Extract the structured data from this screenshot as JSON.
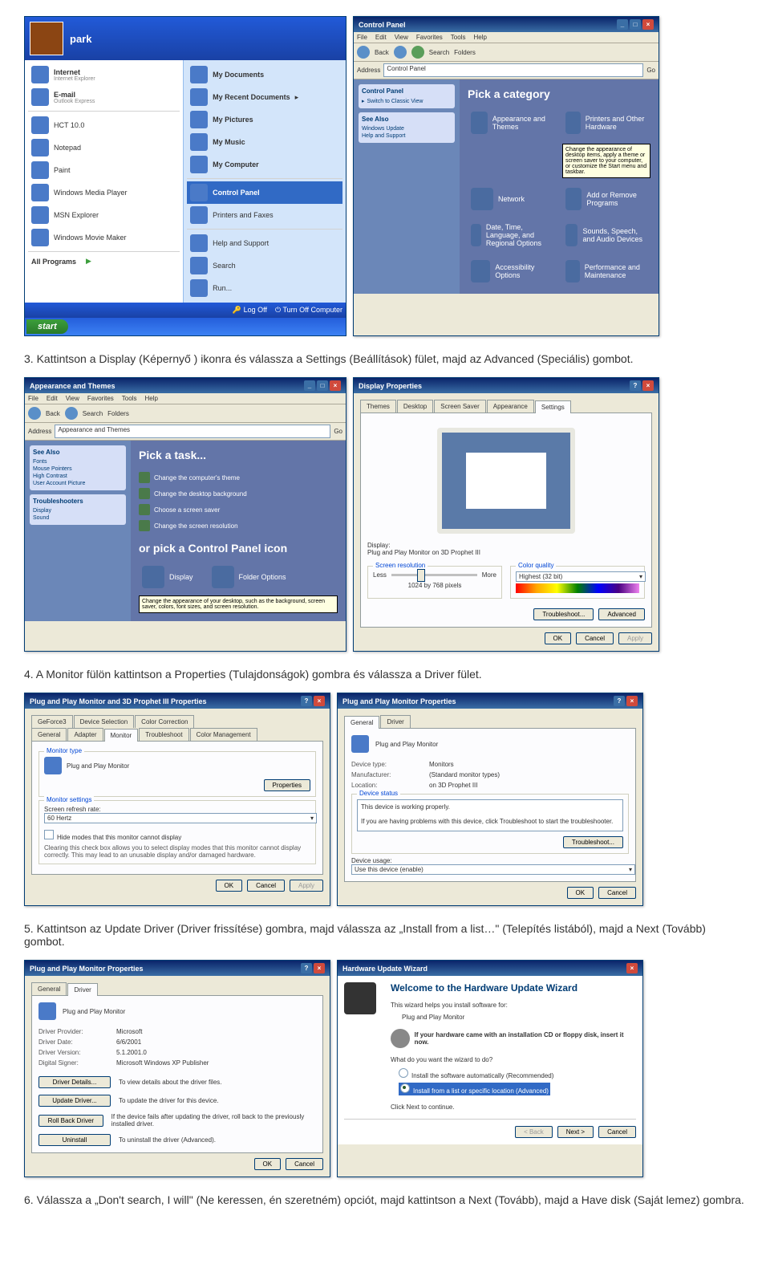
{
  "steps": {
    "s3": "3.  Kattintson a Display (Képernyő ) ikonra és válassza a Settings (Beállítások) fület, majd az Advanced (Speciális) gombot.",
    "s4": "4.  A Monitor fülön kattintson a Properties (Tulajdonságok) gombra és válassza a Driver fület.",
    "s5": "5.  Kattintson az Update Driver (Driver frissítése) gombra, majd válassza az „Install from a list…\" (Telepítés listából), majd a Next (Tovább) gombot.",
    "s6": "6.  Válassza a „Don't search, I will\" (Ne keressen, én szeretném) opciót, majd kattintson a Next (Tovább), majd a Have disk (Saját lemez) gombra."
  },
  "startmenu": {
    "user": "park",
    "left": [
      {
        "t": "Internet",
        "s": "Internet Explorer"
      },
      {
        "t": "E-mail",
        "s": "Outlook Express"
      },
      {
        "t": "HCT 10.0",
        "s": ""
      },
      {
        "t": "Notepad",
        "s": ""
      },
      {
        "t": "Paint",
        "s": ""
      },
      {
        "t": "Windows Media Player",
        "s": ""
      },
      {
        "t": "MSN Explorer",
        "s": ""
      },
      {
        "t": "Windows Movie Maker",
        "s": ""
      }
    ],
    "allprograms": "All Programs",
    "right": [
      "My Documents",
      "My Recent Documents",
      "My Pictures",
      "My Music",
      "My Computer",
      "Control Panel",
      "Printers and Faxes",
      "Help and Support",
      "Search",
      "Run..."
    ],
    "right_hl": "Control Panel",
    "logoff": "Log Off",
    "turnoff": "Turn Off Computer",
    "start": "start"
  },
  "cp": {
    "title": "Control Panel",
    "menus": [
      "File",
      "Edit",
      "View",
      "Favorites",
      "Tools",
      "Help"
    ],
    "back": "Back",
    "search": "Search",
    "folders": "Folders",
    "address": "Address",
    "addrval": "Control Panel",
    "go": "Go",
    "side_title": "Control Panel",
    "switch": "Switch to Classic View",
    "seealso": "See Also",
    "seealso_items": [
      "Windows Update",
      "Help and Support"
    ],
    "header": "Pick a category",
    "cats": [
      "Appearance and Themes",
      "Printers and Other Hardware",
      "Network",
      "Add or Remove Programs",
      "Sounds, Speech, and Audio Devices",
      "Performance and Maintenance",
      "Date, Time, Language, and Regional Options",
      "Accessibility Options"
    ],
    "tooltip": "Change the appearance of desktop items, apply a theme or screen saver to your computer, or customize the Start menu and taskbar."
  },
  "appthemes": {
    "title": "Appearance and Themes",
    "addr": "Appearance and Themes",
    "side_title": "See Also",
    "side1": [
      "Fonts",
      "Mouse Pointers",
      "High Contrast",
      "User Account Picture"
    ],
    "troubleshooters": "Troubleshooters",
    "side2": [
      "Display",
      "Sound"
    ],
    "pickatask": "Pick a task...",
    "tasks": [
      "Change the computer's theme",
      "Change the desktop background",
      "Choose a screen saver",
      "Change the screen resolution"
    ],
    "orpick": "or pick a Control Panel icon",
    "icons": [
      "Display",
      "Folder Options"
    ],
    "tooltip2": "Change the appearance of your desktop, such as the background, screen saver, colors, font sizes, and screen resolution."
  },
  "dispprops": {
    "title": "Display Properties",
    "tabs": [
      "Themes",
      "Desktop",
      "Screen Saver",
      "Appearance",
      "Settings"
    ],
    "display": "Display:",
    "displayval": "Plug and Play Monitor on 3D Prophet III",
    "res": "Screen resolution",
    "less": "Less",
    "more": "More",
    "resval": "1024 by 768 pixels",
    "cq": "Color quality",
    "cqval": "Highest (32 bit)",
    "troubleshoot": "Troubleshoot...",
    "advanced": "Advanced",
    "ok": "OK",
    "cancel": "Cancel",
    "apply": "Apply"
  },
  "monprops": {
    "title": "Plug and Play Monitor and 3D Prophet III Properties",
    "tabs1": [
      "GeForce3",
      "Device Selection",
      "Color Correction"
    ],
    "tabs2": [
      "General",
      "Adapter",
      "Monitor",
      "Troubleshoot",
      "Color Management"
    ],
    "montype": "Monitor type",
    "monname": "Plug and Play Monitor",
    "properties": "Properties",
    "monset": "Monitor settings",
    "refresh": "Screen refresh rate:",
    "refreshval": "60 Hertz",
    "hide": "Hide modes that this monitor cannot display",
    "hidedesc": "Clearing this check box allows you to select display modes that this monitor cannot display correctly. This may lead to an unusable display and/or damaged hardware.",
    "ok": "OK",
    "cancel": "Cancel",
    "apply": "Apply"
  },
  "pnpprops": {
    "title": "Plug and Play Monitor Properties",
    "tabs": [
      "General",
      "Driver"
    ],
    "name": "Plug and Play Monitor",
    "devtype": "Device type:",
    "devtypeval": "Monitors",
    "mfr": "Manufacturer:",
    "mfrval": "(Standard monitor types)",
    "loc": "Location:",
    "locval": "on 3D Prophet III",
    "status": "Device status",
    "statustext": "This device is working properly.",
    "statushelp": "If you are having problems with this device, click Troubleshoot to start the troubleshooter.",
    "troubleshoot": "Troubleshoot...",
    "usage": "Device usage:",
    "usageval": "Use this device (enable)",
    "ok": "OK",
    "cancel": "Cancel"
  },
  "pnpdriver": {
    "title": "Plug and Play Monitor Properties",
    "tabs": [
      "General",
      "Driver"
    ],
    "name": "Plug and Play Monitor",
    "prov": "Driver Provider:",
    "provval": "Microsoft",
    "date": "Driver Date:",
    "dateval": "6/6/2001",
    "ver": "Driver Version:",
    "verval": "5.1.2001.0",
    "sign": "Digital Signer:",
    "signval": "Microsoft Windows XP Publisher",
    "details": "Driver Details...",
    "detailstext": "To view details about the driver files.",
    "update": "Update Driver...",
    "updatetext": "To update the driver for this device.",
    "rollback": "Roll Back Driver",
    "rollbacktext": "If the device fails after updating the driver, roll back to the previously installed driver.",
    "uninstall": "Uninstall",
    "uninstalltext": "To uninstall the driver (Advanced).",
    "ok": "OK",
    "cancel": "Cancel"
  },
  "wizard": {
    "title": "Hardware Update Wizard",
    "welcome": "Welcome to the Hardware Update Wizard",
    "helps": "This wizard helps you install software for:",
    "device": "Plug and Play Monitor",
    "cdtext": "If your hardware came with an installation CD or floppy disk, insert it now.",
    "what": "What do you want the wizard to do?",
    "opt1": "Install the software automatically (Recommended)",
    "opt2": "Install from a list or specific location (Advanced)",
    "clicknext": "Click Next to continue.",
    "back": "< Back",
    "next": "Next >",
    "cancel": "Cancel"
  }
}
